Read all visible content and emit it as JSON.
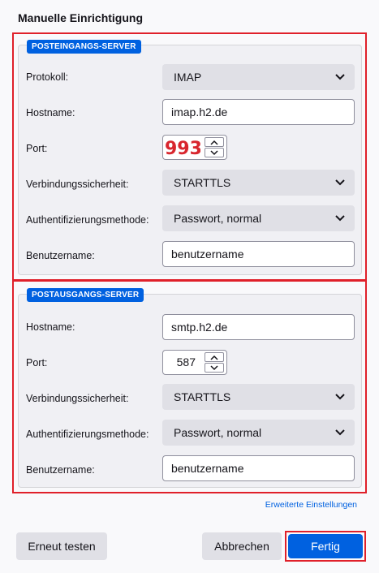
{
  "dialog": {
    "title": "Manuelle Einrichtigung"
  },
  "incoming": {
    "badge": "POSTEINGANGS-SERVER",
    "protocol_label": "Protokoll:",
    "protocol_value": "IMAP",
    "hostname_label": "Hostname:",
    "hostname_value": "imap.h2.de",
    "port_label": "Port:",
    "port_value": "993",
    "security_label": "Verbindungssicherheit:",
    "security_value": "STARTTLS",
    "auth_label": "Authentifizierungsmethode:",
    "auth_value": "Passwort, normal",
    "username_label": "Benutzername:",
    "username_value": "benutzername"
  },
  "outgoing": {
    "badge": "POSTAUSGANGS-SERVER",
    "hostname_label": "Hostname:",
    "hostname_value": "smtp.h2.de",
    "port_label": "Port:",
    "port_value": "587",
    "security_label": "Verbindungssicherheit:",
    "security_value": "STARTTLS",
    "auth_label": "Authentifizierungsmethode:",
    "auth_value": "Passwort, normal",
    "username_label": "Benutzername:",
    "username_value": "benutzername"
  },
  "advanced_link": "Erweiterte Einstellungen",
  "buttons": {
    "retest": "Erneut testen",
    "cancel": "Abbrechen",
    "done": "Fertig"
  },
  "colors": {
    "accent": "#0061e0",
    "highlight": "#e0202a",
    "annotation": "#d8262e"
  }
}
